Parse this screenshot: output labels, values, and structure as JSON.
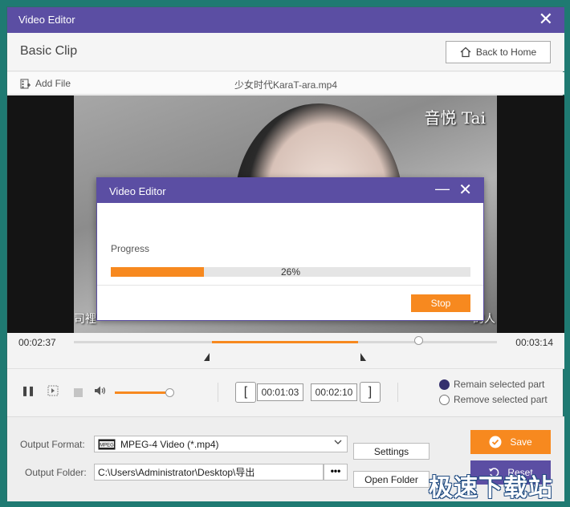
{
  "window": {
    "title": "Video Editor",
    "close_glyph": "✕"
  },
  "header": {
    "title": "Basic Clip",
    "back_label": "Back to Home"
  },
  "filebar": {
    "add_label": "Add File",
    "filename": "少女时代KaraT-ara.mp4"
  },
  "video": {
    "watermark": "音悦 Tai",
    "subtitle_left": "司裡",
    "subtitle_right": "的人"
  },
  "dialog": {
    "title": "Video Editor",
    "min_glyph": "—",
    "close_glyph": "✕",
    "progress_label": "Progress",
    "progress_text": "26%",
    "progress_value": 0.26,
    "stop_label": "Stop"
  },
  "timeline": {
    "start_time": "00:02:37",
    "end_time": "00:03:14",
    "selection_start": 0.326,
    "selection_end": 0.672,
    "playhead": 0.815
  },
  "controls": {
    "pause_glyph": "❚❚",
    "volume_level": 0.9,
    "clip_start": "00:01:03",
    "clip_end": "00:02:10",
    "bracket_left": "[",
    "bracket_right": "]",
    "remain_label": "Remain selected part",
    "remove_label": "Remove selected part",
    "remain_selected": true
  },
  "output": {
    "format_label": "Output Format:",
    "format_value": "MPEG-4 Video (*.mp4)",
    "settings_label": "Settings",
    "folder_label": "Output Folder:",
    "folder_value": "C:\\Users\\Administrator\\Desktop\\导出",
    "browse_label": "•••",
    "open_folder_label": "Open Folder",
    "save_label": "Save",
    "reset_label": "Reset"
  },
  "site_watermark": "极速下载站",
  "colors": {
    "accent": "#f7891f",
    "brand": "#5b4ea3",
    "window_bg": "#f3f3f3"
  }
}
